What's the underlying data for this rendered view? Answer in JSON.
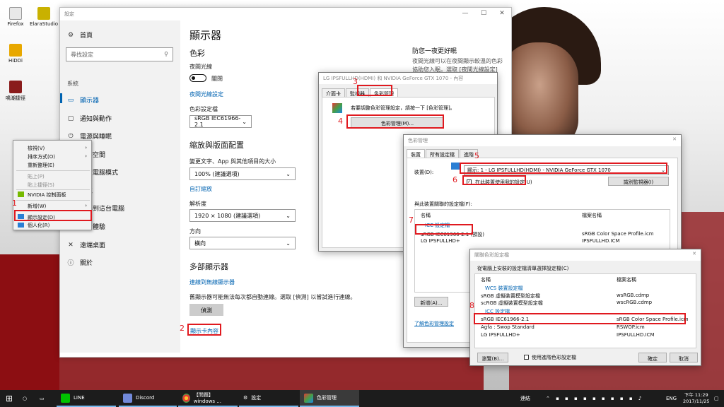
{
  "desktop": {
    "icons": [
      {
        "label": "Firefox"
      },
      {
        "label": "ElaraStudio"
      },
      {
        "label": "HiDDi"
      },
      {
        "label": "鳴潮捷徑"
      }
    ]
  },
  "context_menu": {
    "items": [
      "檢視(V)",
      "排序方式(O)",
      "重新整理(E)",
      "貼上(P)",
      "貼上捷徑(S)",
      "NVIDIA 控制面板",
      "新增(W)",
      "顯示設定(D)",
      "個人化(R)"
    ]
  },
  "settings": {
    "window_title": "設定",
    "nav": {
      "home": "首頁",
      "search_placeholder": "尋找設定",
      "section": "系統",
      "items": [
        "顯示器",
        "通知與動作",
        "電源與睡眠",
        "儲存空間",
        "平板電腦模式",
        "多工",
        "投影到這台電腦",
        "共用體驗",
        "遠端桌面",
        "關於"
      ]
    },
    "page_title": "顯示器",
    "color": {
      "heading": "色彩",
      "night_light_label": "夜間光線",
      "night_light_state": "關閉",
      "night_light_settings_link": "夜間光線設定",
      "color_profile_label": "色彩設定檔",
      "color_profile_value": "sRGB IEC61966-2.1"
    },
    "scale": {
      "heading": "縮放與版面配置",
      "text_size_label": "變更文字、App 與其他項目的大小",
      "text_size_value": "100% (建議選項)",
      "custom_scaling_link": "自訂縮放",
      "resolution_label": "解析度",
      "resolution_value": "1920 × 1080 (建議選項)",
      "orientation_label": "方向",
      "orientation_value": "橫向"
    },
    "multi": {
      "heading": "多部顯示器",
      "wireless_link": "連線到無線顯示器",
      "detect_desc": "舊顯示器可能無法每次都自動連線。選取 [偵測] 以嘗試進行連線。",
      "detect_button": "偵測",
      "adapter_link": "顯示卡內容"
    },
    "side": {
      "heading": "防您一夜更好眠",
      "desc1": "夜間光線可以在夜間顯示較溫的色彩",
      "desc2": "協助您入眠。選取 [夜間光線設定]"
    }
  },
  "props_dialog": {
    "title": "LG IPSFULLHD(HDMI) 和 NVIDIA GeForce GTX 1070 - 內容",
    "tabs": [
      "介面卡",
      "監視器",
      "色彩管理"
    ],
    "desc": "若要調整色彩管理設定，請按一下 [色彩管理]。",
    "button": "色彩管理(M)..."
  },
  "cm_dialog": {
    "title": "色彩管理",
    "tabs": [
      "裝置",
      "所有設定檔",
      "進階"
    ],
    "device_label": "裝置(D):",
    "device_value": "顯示: 1 - LG IPSFULLHD(HDMI) - NVIDIA GeForce GTX 1070",
    "use_settings_label": "在此裝置使用我的設定(U)",
    "identify_button": "識別監視器(I)",
    "profiles_caption": "與此裝置關聯的設定檔(F):",
    "col_name": "名稱",
    "col_file": "檔案名稱",
    "group": "ICC 設定檔",
    "profiles": [
      {
        "name": "sRGB IEC61966-2.1 (預設)",
        "file": "sRGB Color Space Profile.icm"
      },
      {
        "name": "LG IPSFULLHD+",
        "file": "IPSFULLHD.ICM"
      }
    ],
    "add_button": "新增(A)...",
    "link": "了解色彩管理設定"
  },
  "assoc_dialog": {
    "title": "關聯色彩設定檔",
    "caption": "從電腦上安裝的設定檔清單選擇設定檔(C)",
    "col_name": "名稱",
    "col_file": "檔案名稱",
    "wcs_group": "WCS 裝置設定檔",
    "wcs_items": [
      {
        "name": "sRGB 虛擬裝置模型設定檔",
        "file": "wsRGB.cdmp"
      },
      {
        "name": "scRGB 虛擬裝置模型設定檔",
        "file": "wscRGB.cdmp"
      }
    ],
    "icc_group": "ICC 設定檔",
    "icc_items": [
      {
        "name": "sRGB IEC61966-2.1",
        "file": "sRGB Color Space Profile.icm"
      },
      {
        "name": "Agfa : Swop Standard",
        "file": "RSWOP.icm"
      },
      {
        "name": "LG IPSFULLHD+",
        "file": "IPSFULLHD.ICM"
      }
    ],
    "browse_button": "瀏覽(B)...",
    "advanced_label": "使用進階色彩設定檔",
    "ok_button": "確定",
    "cancel_button": "取消"
  },
  "annotations": [
    "1",
    "2",
    "3",
    "4",
    "5",
    "6",
    "7",
    "8"
  ],
  "taskbar": {
    "items": [
      {
        "label": "LINE"
      },
      {
        "label": "Discord"
      },
      {
        "label": "【問題】windows ..."
      },
      {
        "label": "設定"
      },
      {
        "label": "色彩管理"
      }
    ],
    "tray_label": "連結",
    "ime": "ENG",
    "time": "下午 11:29",
    "date": "2017/11/25"
  },
  "colors": {
    "highlight": "#e0191f",
    "accent": "#0063b1",
    "taskbar": "#1c1c1c"
  }
}
